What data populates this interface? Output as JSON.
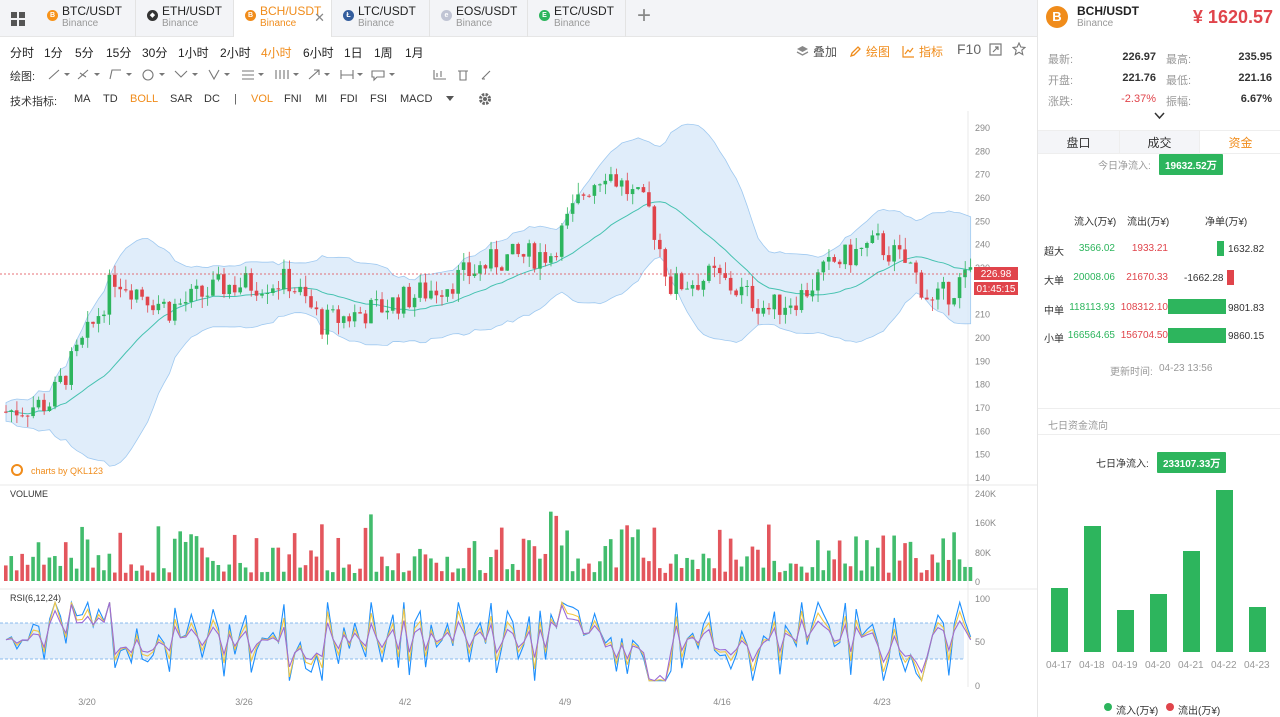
{
  "tabs": [
    {
      "pair": "BTC/USDT",
      "exchange": "Binance",
      "color": "#f7931a",
      "glyph": "B",
      "active": false
    },
    {
      "pair": "ETH/USDT",
      "exchange": "Binance",
      "color": "#333333",
      "glyph": "◆",
      "active": false
    },
    {
      "pair": "BCH/USDT",
      "exchange": "Binance",
      "color": "#f08c1b",
      "glyph": "B",
      "active": true,
      "close": "✕"
    },
    {
      "pair": "LTC/USDT",
      "exchange": "Binance",
      "color": "#345d9d",
      "glyph": "Ł",
      "active": false
    },
    {
      "pair": "EOS/USDT",
      "exchange": "Binance",
      "color": "#c0c4d4",
      "glyph": "e",
      "active": false
    },
    {
      "pair": "ETC/USDT",
      "exchange": "Binance",
      "color": "#2db55d",
      "glyph": "E",
      "active": false
    }
  ],
  "add_tab": "+",
  "periods": [
    "分时",
    "1分",
    "5分",
    "15分",
    "30分",
    "1小时",
    "2小时",
    "4小时",
    "6小时",
    "1日",
    "1周",
    "1月"
  ],
  "active_period": "4小时",
  "tools": {
    "overlay": "叠加",
    "draw": "绘图",
    "indicator": "指标",
    "f10": "F10"
  },
  "draw_label": "绘图:",
  "indicator_label": "技术指标:",
  "main_indicators": [
    "MA",
    "TD",
    "BOLL",
    "SAR",
    "DC"
  ],
  "sub_indicators": [
    "VOL",
    "FNI",
    "MI",
    "FDI",
    "FSI",
    "MACD"
  ],
  "active_main": "BOLL",
  "active_sub": "VOL",
  "chart_data": {
    "type": "candlestick",
    "price_axis": [
      "290",
      "280",
      "270",
      "260",
      "250",
      "240",
      "230",
      "220",
      "210",
      "200",
      "190",
      "180",
      "170",
      "160",
      "150",
      "140"
    ],
    "last_price": "226.98",
    "countdown": "01:45:15",
    "watermark": "charts by QKL123",
    "volume_label": "VOLUME",
    "volume_axis": [
      "240K",
      "160K",
      "80K",
      "0"
    ],
    "rsi_label": "RSI(6,12,24)",
    "rsi_axis": [
      "100",
      "50",
      "0"
    ],
    "x_labels": [
      "3/20",
      "3/26",
      "4/2",
      "4/9",
      "4/16",
      "4/23"
    ],
    "ylim": [
      140,
      290
    ],
    "series_colors": {
      "up": "#2db55d",
      "down": "#e0444b",
      "boll_band": "#dbeafa",
      "boll_mid": "#46c2b0",
      "rsi6": "#1e8ffc",
      "rsi12": "#f2c744",
      "rsi24": "#9a6bd6"
    }
  },
  "panel": {
    "pair": "BCH/USDT",
    "exchange": "Binance",
    "price": "¥ 1620.57",
    "stats": [
      {
        "label": "最新:",
        "value": "226.97",
        "label2": "最高:",
        "value2": "235.95"
      },
      {
        "label": "开盘:",
        "value": "221.76",
        "label2": "最低:",
        "value2": "221.16"
      },
      {
        "label": "涨跌:",
        "value": "-2.37%",
        "label2": "振幅:",
        "value2": "6.67%"
      }
    ],
    "subtabs": [
      "盘口",
      "成交",
      "资金"
    ],
    "today_label": "今日净流入:",
    "today_value": "19632.52万",
    "headers": [
      "流入(万¥)",
      "流出(万¥)",
      "净单(万¥)"
    ],
    "rows": [
      {
        "type": "超大",
        "inflow": "3566.02",
        "outflow": "1933.21",
        "net": "1632.82",
        "net_value": 1632.82
      },
      {
        "type": "大单",
        "inflow": "20008.06",
        "outflow": "21670.33",
        "net": "-1662.28",
        "net_value": -1662.28
      },
      {
        "type": "中单",
        "inflow": "118113.93",
        "outflow": "108312.10",
        "net": "9801.83",
        "net_value": 9801.83
      },
      {
        "type": "小单",
        "inflow": "166564.65",
        "outflow": "156704.50",
        "net": "9860.15",
        "net_value": 9860.15
      }
    ],
    "update_label": "更新时间:",
    "update_time": "04-23 13:56",
    "seven_title": "七日资金流向",
    "seven_label": "七日净流入:",
    "seven_value": "233107.33万",
    "seven_days": [
      "04-17",
      "04-18",
      "04-19",
      "04-20",
      "04-21",
      "04-22",
      "04-23"
    ],
    "seven_values": [
      20500,
      40300,
      13500,
      18700,
      32300,
      52000,
      14500
    ],
    "legend_in": "流入(万¥)",
    "legend_out": "流出(万¥)"
  }
}
